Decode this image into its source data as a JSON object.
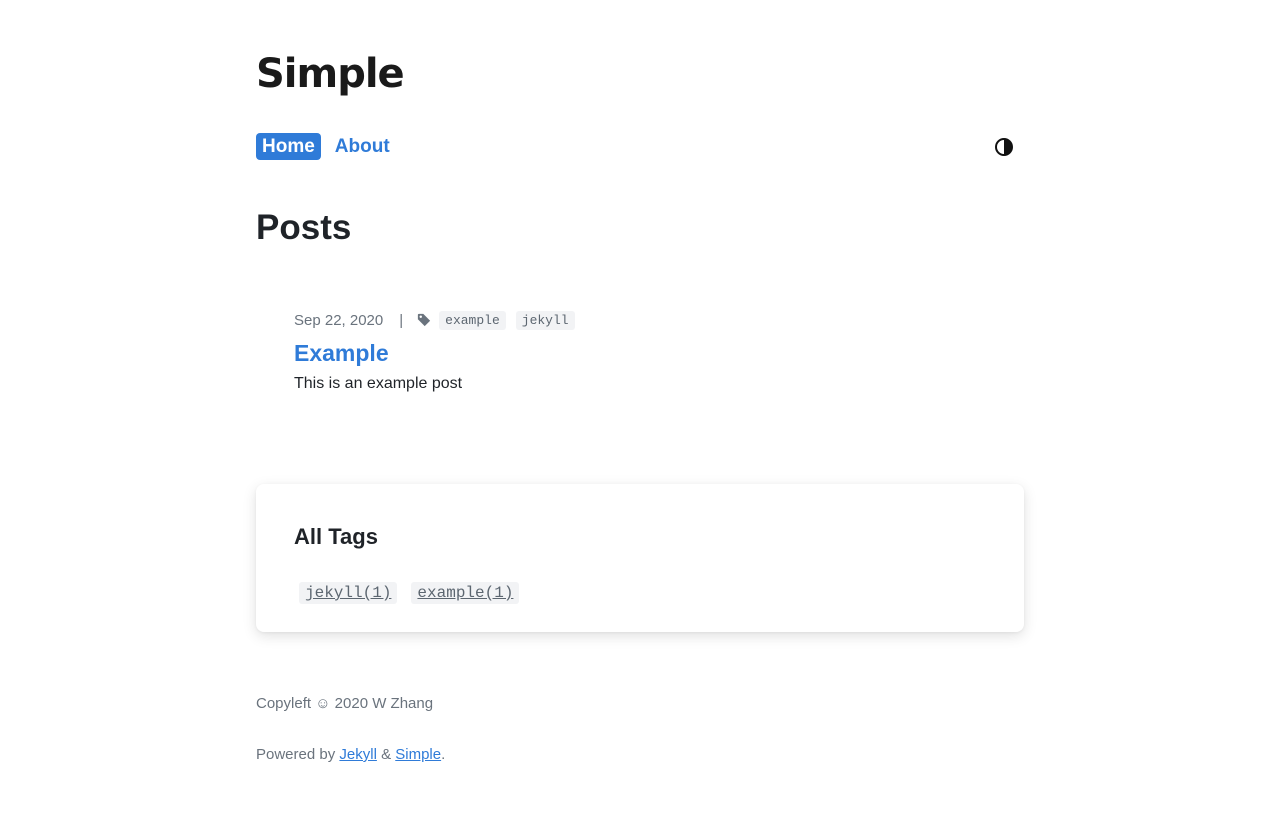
{
  "site": {
    "logo": "Simple"
  },
  "nav": {
    "items": [
      {
        "label": "Home",
        "active": true
      },
      {
        "label": "About",
        "active": false
      }
    ],
    "theme_toggle_icon": "contrast-icon"
  },
  "page": {
    "title": "Posts"
  },
  "posts": [
    {
      "date": "Sep 22, 2020",
      "separator": "|",
      "tag_icon": "tag-icon",
      "tags": [
        "example",
        "jekyll"
      ],
      "title": "Example",
      "excerpt": "This is an example post"
    }
  ],
  "all_tags": {
    "heading": "All Tags",
    "tags": [
      "jekyll(1)",
      "example(1)"
    ]
  },
  "footer": {
    "copyleft": "Copyleft ☺ 2020 W Zhang",
    "powered_prefix": "Powered by ",
    "jekyll_link": "Jekyll",
    "amp": " & ",
    "simple_link": "Simple",
    "period": "."
  },
  "colors": {
    "accent": "#2f7bd8",
    "text": "#1f2328",
    "muted": "#6a737d",
    "chip_bg": "#f2f3f5"
  }
}
